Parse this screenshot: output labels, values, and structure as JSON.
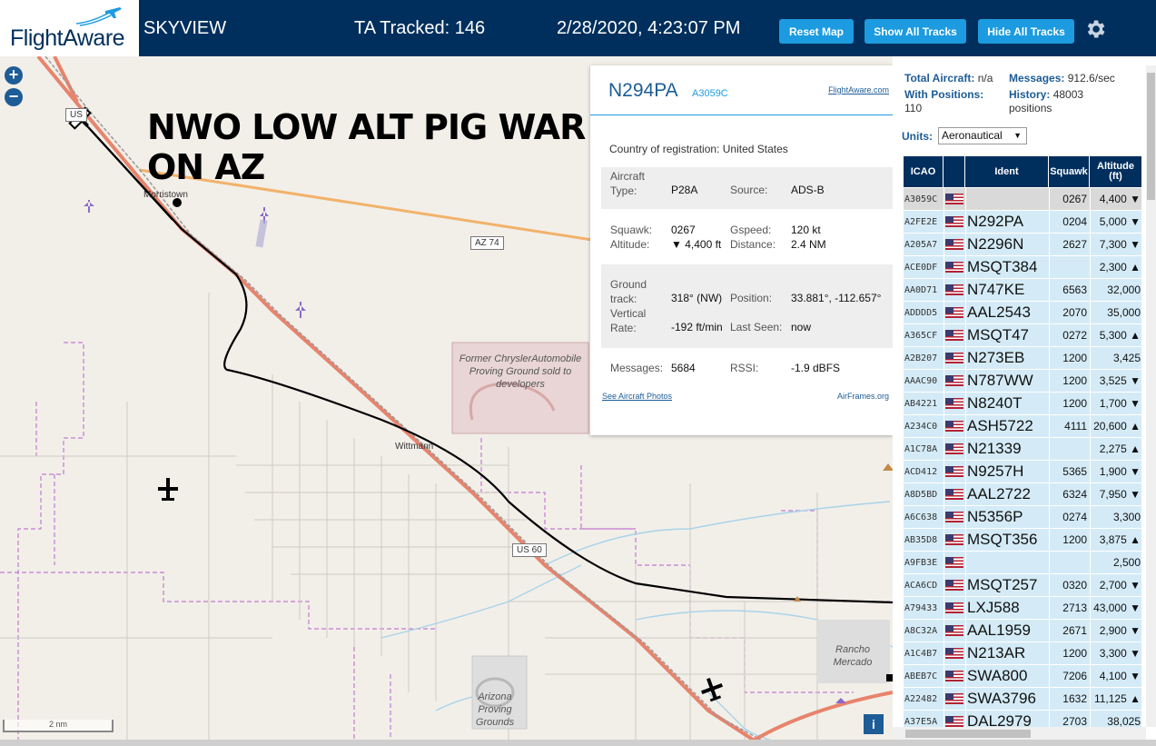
{
  "header": {
    "logo_text": "FlightAware",
    "app_title": "SKYVIEW",
    "tracked": "TA Tracked: 146",
    "datetime": "2/28/2020, 4:23:07 PM",
    "reset_map": "Reset Map",
    "show_all": "Show All Tracks",
    "hide_all": "Hide All Tracks",
    "settings_icon": "gear-icon"
  },
  "map": {
    "zoom_in": "+",
    "zoom_out": "−",
    "overlay_line1": "NWO LOW ALT PIG WAR",
    "overlay_line2": "ON AZ",
    "labels": {
      "morristown": "Morristown",
      "wittmann": "Wittmann",
      "az74": "AZ 74",
      "us60": "US 60",
      "us_top": "US",
      "rancho": "Rancho Mercado",
      "chrysler": "Former ChryslerAutomobile Proving Ground sold to developers",
      "arizona": "Arizona Proving Grounds"
    },
    "scale": "2 nm",
    "info": "i"
  },
  "popup": {
    "registration": "N294PA",
    "hex": "A3059C",
    "fa_link": "FlightAware.com",
    "country_label": "Country of registration:",
    "country": "United States",
    "aircraft_type_label": "Aircraft Type:",
    "aircraft_type": "P28A",
    "source_label": "Source:",
    "source": "ADS-B",
    "squawk_label": "Squawk:",
    "squawk": "0267",
    "gspeed_label": "Gspeed:",
    "gspeed": "120 kt",
    "altitude_label": "Altitude:",
    "altitude": "▼ 4,400 ft",
    "distance_label": "Distance:",
    "distance": "2.4 NM",
    "ground_track_label": "Ground track:",
    "ground_track": "318° (NW)",
    "position_label": "Position:",
    "position": "33.881°, -112.657°",
    "vrate_label": "Vertical Rate:",
    "vrate": "-192 ft/min",
    "last_seen_label": "Last Seen:",
    "last_seen": "now",
    "messages_label": "Messages:",
    "messages": "5684",
    "rssi_label": "RSSI:",
    "rssi": "-1.9 dBFS",
    "photos_link": "See Aircraft Photos",
    "airframes_link": "AirFrames.org"
  },
  "sidebar": {
    "total_aircraft_label": "Total Aircraft:",
    "total_aircraft": "n/a",
    "messages_label": "Messages:",
    "messages": "912.6/sec",
    "with_positions_label": "With Positions:",
    "with_positions": "110",
    "history_label": "History:",
    "history": "48003 positions",
    "units_label": "Units:",
    "units_value": "Aeronautical",
    "columns": [
      "ICAO",
      "",
      "Ident",
      "Squawk",
      "Altitude (ft)"
    ],
    "rows": [
      {
        "icao": "A3059C",
        "ident": "",
        "squawk": "0267",
        "alt": "4,400 ▼",
        "selected": true
      },
      {
        "icao": "A2FE2E",
        "ident": "N292PA",
        "squawk": "0204",
        "alt": "5,000 ▼"
      },
      {
        "icao": "A205A7",
        "ident": "N2296N",
        "squawk": "2627",
        "alt": "7,300 ▼"
      },
      {
        "icao": "ACE0DF",
        "ident": "MSQT384",
        "squawk": "",
        "alt": "2,300 ▲"
      },
      {
        "icao": "AA0D71",
        "ident": "N747KE",
        "squawk": "6563",
        "alt": "32,000"
      },
      {
        "icao": "ADDDD5",
        "ident": "AAL2543",
        "squawk": "2070",
        "alt": "35,000"
      },
      {
        "icao": "A365CF",
        "ident": "MSQT47",
        "squawk": "0272",
        "alt": "5,300 ▲"
      },
      {
        "icao": "A2B207",
        "ident": "N273EB",
        "squawk": "1200",
        "alt": "3,425"
      },
      {
        "icao": "AAAC90",
        "ident": "N787WW",
        "squawk": "1200",
        "alt": "3,525 ▼"
      },
      {
        "icao": "AB4221",
        "ident": "N8240T",
        "squawk": "1200",
        "alt": "1,700 ▼"
      },
      {
        "icao": "A234C0",
        "ident": "ASH5722",
        "squawk": "4111",
        "alt": "20,600 ▲"
      },
      {
        "icao": "A1C78A",
        "ident": "N21339",
        "squawk": "",
        "alt": "2,275 ▲"
      },
      {
        "icao": "ACD412",
        "ident": "N9257H",
        "squawk": "5365",
        "alt": "1,900 ▼"
      },
      {
        "icao": "A8D5BD",
        "ident": "AAL2722",
        "squawk": "6324",
        "alt": "7,950 ▼"
      },
      {
        "icao": "A6C638",
        "ident": "N5356P",
        "squawk": "0274",
        "alt": "3,300"
      },
      {
        "icao": "AB35D8",
        "ident": "MSQT356",
        "squawk": "1200",
        "alt": "3,875 ▲"
      },
      {
        "icao": "A9FB3E",
        "ident": "",
        "squawk": "",
        "alt": "2,500"
      },
      {
        "icao": "ACA6CD",
        "ident": "MSQT257",
        "squawk": "0320",
        "alt": "2,700 ▼"
      },
      {
        "icao": "A79433",
        "ident": "LXJ588",
        "squawk": "2713",
        "alt": "43,000 ▼"
      },
      {
        "icao": "A8C32A",
        "ident": "AAL1959",
        "squawk": "2671",
        "alt": "2,900 ▼"
      },
      {
        "icao": "A1C4B7",
        "ident": "N213AR",
        "squawk": "1200",
        "alt": "3,300 ▼"
      },
      {
        "icao": "ABEB7C",
        "ident": "SWA800",
        "squawk": "7206",
        "alt": "4,100 ▼"
      },
      {
        "icao": "A22482",
        "ident": "SWA3796",
        "squawk": "1632",
        "alt": "11,125 ▲"
      },
      {
        "icao": "A37E5A",
        "ident": "DAL2979",
        "squawk": "2703",
        "alt": "38,025"
      }
    ]
  },
  "colors": {
    "header_bg": "#002f5d",
    "button_bg": "#1c9be0",
    "row_bg": "#d4ebf7",
    "track_line": "#000000",
    "highway": "#e8836c",
    "state_route": "#f2b26b"
  }
}
